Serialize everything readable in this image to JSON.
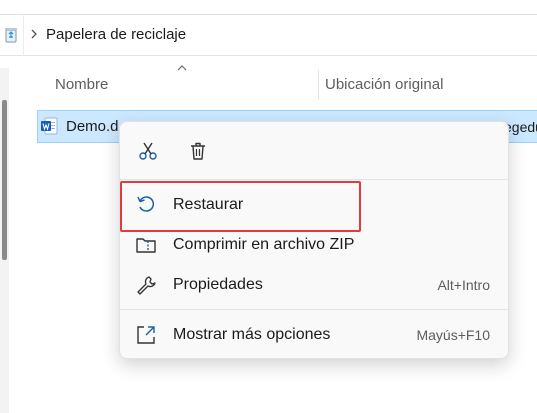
{
  "address_bar": {
    "path_label": "Papelera de reciclaje"
  },
  "columns": {
    "name": "Nombre",
    "original_location": "Ubicación original"
  },
  "file": {
    "name": "Demo.d",
    "location_fragment": "egedu"
  },
  "context_menu": {
    "quick_actions": [
      {
        "icon": "cut-icon",
        "label": "Cortar"
      },
      {
        "icon": "delete-icon",
        "label": "Eliminar"
      }
    ],
    "items": [
      {
        "icon": "restore-icon",
        "label": "Restaurar",
        "shortcut": ""
      },
      {
        "icon": "zip-folder-icon",
        "label": "Comprimir en archivo ZIP",
        "shortcut": ""
      },
      {
        "icon": "wrench-icon",
        "label": "Propiedades",
        "shortcut": "Alt+Intro"
      },
      {
        "icon": "more-options-icon",
        "label": "Mostrar más opciones",
        "shortcut": "Mayús+F10"
      }
    ]
  },
  "colors": {
    "selection": "#cce8ff",
    "selection_border": "#99d1ff",
    "highlight_box": "#e03c3c",
    "accent": "#005fb8"
  }
}
